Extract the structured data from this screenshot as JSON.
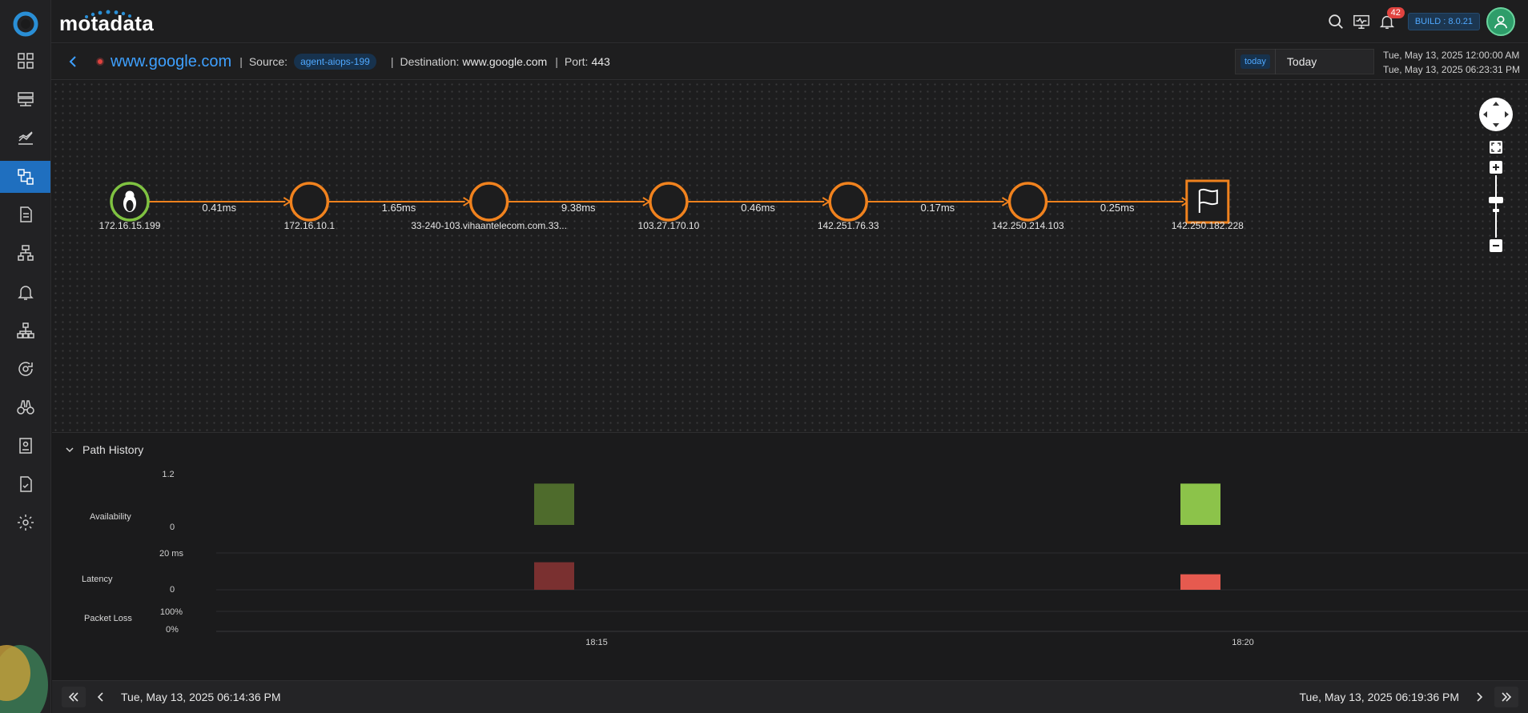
{
  "brand": {
    "name": "motadata"
  },
  "header": {
    "notifications_count": "42",
    "build": "BUILD : 8.0.21"
  },
  "path": {
    "host": "www.google.com",
    "source_label": "Source:",
    "source_value": "agent-aiops-199",
    "destination_label": "Destination:",
    "destination_value": "www.google.com",
    "port_label": "Port:",
    "port_value": "443"
  },
  "timerange": {
    "pill": "today",
    "label": "Today",
    "start": "Tue, May 13, 2025 12:00:00 AM",
    "end": "Tue, May 13, 2025 06:23:31 PM"
  },
  "hops": [
    {
      "label": "172.16.15.199",
      "type": "source"
    },
    {
      "label": "172.16.10.1",
      "type": "hop"
    },
    {
      "label": "33-240-103.vihaantelecom.com.33...",
      "type": "hop"
    },
    {
      "label": "103.27.170.10",
      "type": "hop"
    },
    {
      "label": "142.251.76.33",
      "type": "hop"
    },
    {
      "label": "142.250.214.103",
      "type": "hop"
    },
    {
      "label": "142.250.182.228",
      "type": "destination"
    }
  ],
  "links": [
    "0.41ms",
    "1.65ms",
    "9.38ms",
    "0.46ms",
    "0.17ms",
    "0.25ms"
  ],
  "colors": {
    "link": "#f0821e",
    "source_ring": "#7fc241",
    "avail_1": "#4e6b2c",
    "avail_2": "#8cc34a",
    "lat_1": "#7a3030",
    "lat_2": "#e65a4f"
  },
  "history": {
    "title": "Path History",
    "rows": {
      "availability": "Availability",
      "latency": "Latency",
      "packet_loss": "Packet Loss"
    },
    "axes": {
      "avail_max": "1.2",
      "avail_min": "0",
      "lat_max": "20 ms",
      "lat_min": "0",
      "loss_max": "100%",
      "loss_min": "0%"
    },
    "x_ticks": [
      "18:15",
      "18:20"
    ]
  },
  "chart_data": {
    "type": "bar",
    "categories": [
      "18:15",
      "18:20"
    ],
    "series": [
      {
        "name": "Availability",
        "values": [
          1,
          1
        ]
      },
      {
        "name": "Latency",
        "values": [
          16,
          9
        ]
      },
      {
        "name": "Packet Loss",
        "values": [
          0,
          0
        ]
      }
    ]
  },
  "footer": {
    "start": "Tue, May 13, 2025 06:14:36 PM",
    "end": "Tue, May 13, 2025 06:19:36 PM"
  }
}
